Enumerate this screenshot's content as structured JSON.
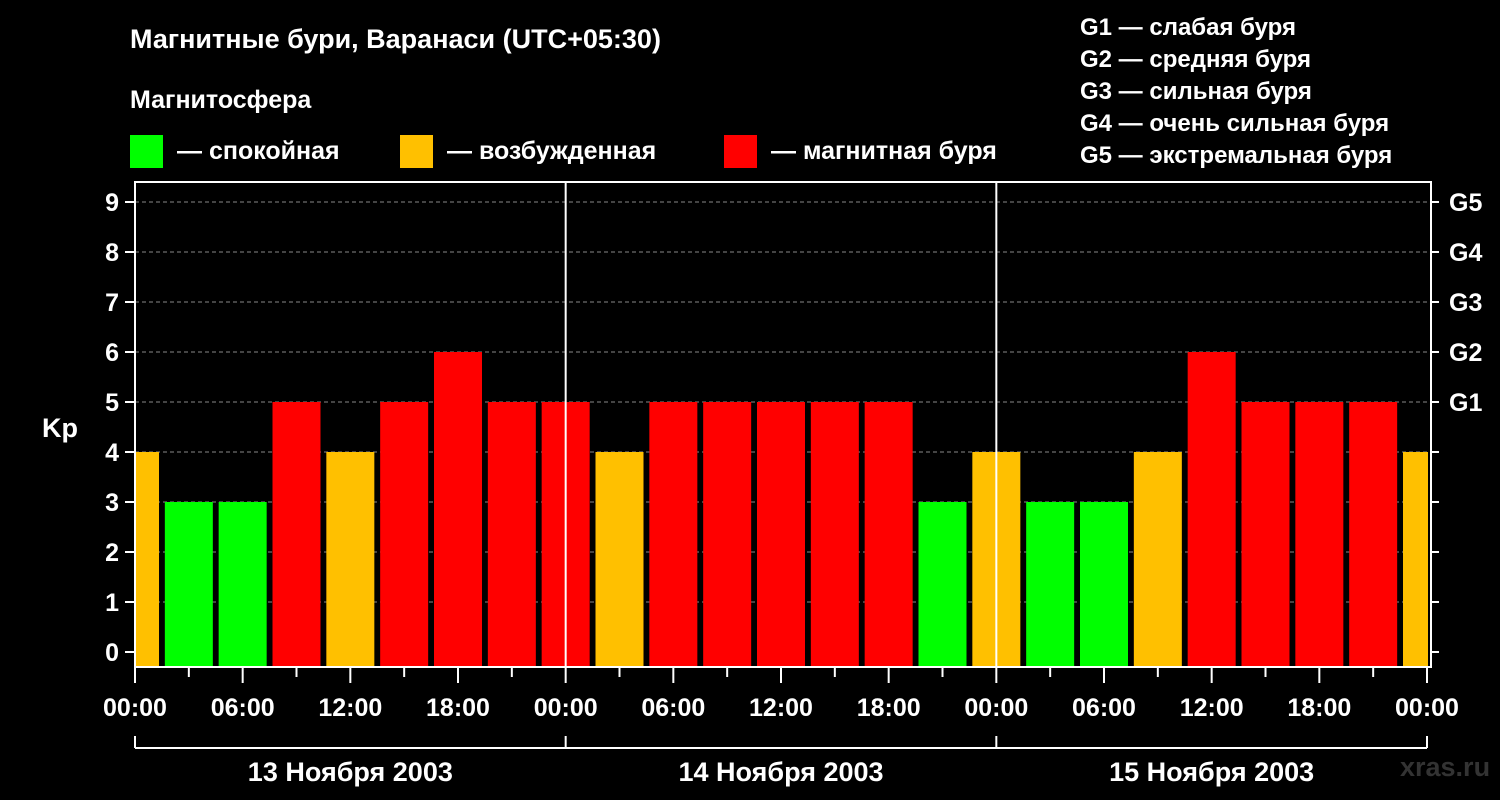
{
  "title": "Магнитные бури, Варанаси (UTC+05:30)",
  "subtitle": "Магнитосфера",
  "legend": [
    {
      "label": "— спокойная",
      "color": "#00ff00"
    },
    {
      "label": "— возбужденная",
      "color": "#ffc000"
    },
    {
      "label": "— магнитная буря",
      "color": "#ff0000"
    }
  ],
  "g_legend": [
    "G1 — слабая буря",
    "G2 — средняя буря",
    "G3 — сильная буря",
    "G4 — очень сильная буря",
    "G5 — экстремальная буря"
  ],
  "watermark": "xras.ru",
  "chart_data": {
    "type": "bar",
    "ylabel": "Kp",
    "ylim": [
      0,
      9
    ],
    "yticks": [
      "0",
      "1",
      "2",
      "3",
      "4",
      "5",
      "6",
      "7",
      "8",
      "9"
    ],
    "g_levels": [
      {
        "label": "G1",
        "kp": 5
      },
      {
        "label": "G2",
        "kp": 6
      },
      {
        "label": "G3",
        "kp": 7
      },
      {
        "label": "G4",
        "kp": 8
      },
      {
        "label": "G5",
        "kp": 9
      }
    ],
    "xticks": [
      "00:00",
      "06:00",
      "12:00",
      "18:00",
      "00:00",
      "06:00",
      "12:00",
      "18:00",
      "00:00",
      "06:00",
      "12:00",
      "18:00",
      "00:00"
    ],
    "days": [
      "13 Ноября 2003",
      "14 Ноября 2003",
      "15 Ноября 2003"
    ],
    "x_hours": [
      0,
      3,
      6,
      9,
      12,
      15,
      18,
      21,
      24,
      27,
      30,
      33,
      36,
      39,
      42,
      45,
      48,
      51,
      54,
      57,
      60,
      63,
      66,
      69,
      72
    ],
    "values": [
      4,
      3,
      3,
      5,
      4,
      5,
      6,
      5,
      5,
      4,
      5,
      5,
      5,
      5,
      5,
      3,
      4,
      3,
      3,
      4,
      6,
      5,
      5,
      5,
      4
    ],
    "colors": {
      "calm": "#00ff00",
      "active": "#ffc000",
      "storm": "#ff0000"
    },
    "grid": true,
    "legend_position": "top"
  }
}
